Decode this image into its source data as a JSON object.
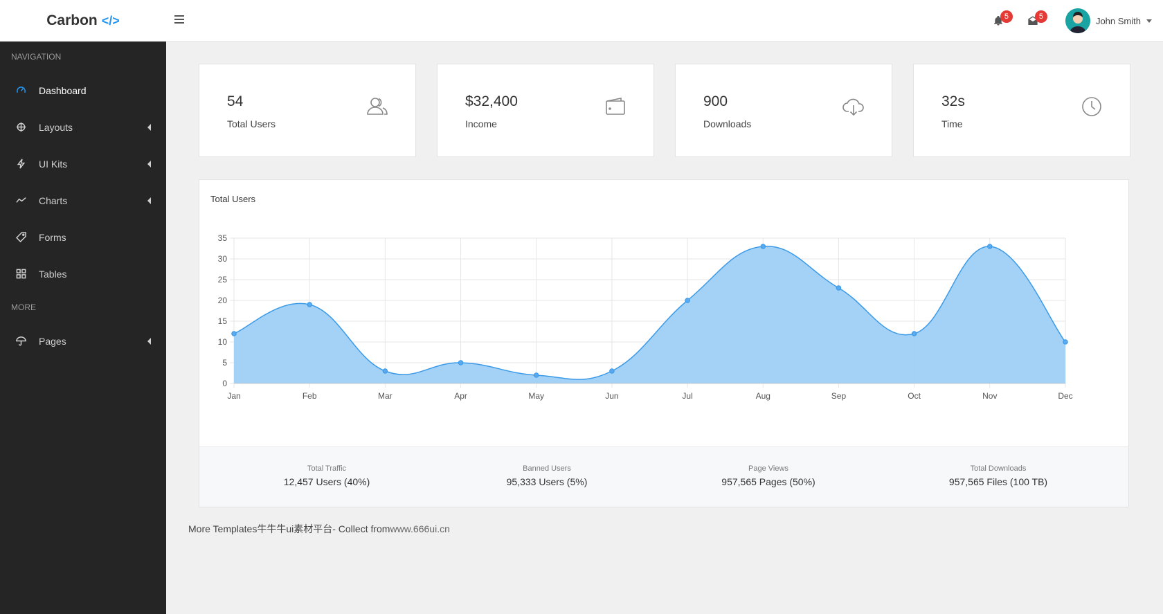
{
  "brand": {
    "name": "Carbon",
    "code": "</>"
  },
  "header": {
    "notifications_count": "5",
    "messages_count": "5",
    "user_name": "John Smith"
  },
  "sidebar": {
    "section_navigation": "NAVIGATION",
    "section_more": "MORE",
    "items": [
      {
        "label": "Dashboard",
        "icon": "gauge-icon",
        "active": true
      },
      {
        "label": "Layouts",
        "icon": "crosshair-icon"
      },
      {
        "label": "UI Kits",
        "icon": "bolt-icon"
      },
      {
        "label": "Charts",
        "icon": "line-chart-icon"
      },
      {
        "label": "Forms",
        "icon": "tag-icon"
      },
      {
        "label": "Tables",
        "icon": "grid-icon"
      }
    ],
    "more_items": [
      {
        "label": "Pages",
        "icon": "umbrella-icon"
      }
    ]
  },
  "cards": [
    {
      "value": "54",
      "label": "Total Users",
      "icon": "users-icon"
    },
    {
      "value": "$32,400",
      "label": "Income",
      "icon": "wallet-icon"
    },
    {
      "value": "900",
      "label": "Downloads",
      "icon": "cloud-download-icon"
    },
    {
      "value": "32s",
      "label": "Time",
      "icon": "clock-icon"
    }
  ],
  "chart_data": {
    "type": "area",
    "title": "Total Users",
    "categories": [
      "Jan",
      "Feb",
      "Mar",
      "Apr",
      "May",
      "Jun",
      "Jul",
      "Aug",
      "Sep",
      "Oct",
      "Nov",
      "Dec"
    ],
    "values": [
      12,
      19,
      3,
      5,
      2,
      3,
      20,
      33,
      23,
      12,
      33,
      10
    ],
    "ylim": [
      0,
      35
    ],
    "yticks": [
      0,
      5,
      10,
      15,
      20,
      25,
      30,
      35
    ],
    "grid": true,
    "fill_color": "#9fd0f7",
    "line_color": "#3b9ae8"
  },
  "stats": [
    {
      "label": "Total Traffic",
      "value": "12,457 Users (40%)"
    },
    {
      "label": "Banned Users",
      "value": "95,333 Users (5%)"
    },
    {
      "label": "Page Views",
      "value": "957,565 Pages (50%)"
    },
    {
      "label": "Total Downloads",
      "value": "957,565 Files (100 TB)"
    }
  ],
  "footer": {
    "text": "More Templates牛牛牛ui素材平台- Collect from",
    "link": "www.666ui.cn"
  }
}
